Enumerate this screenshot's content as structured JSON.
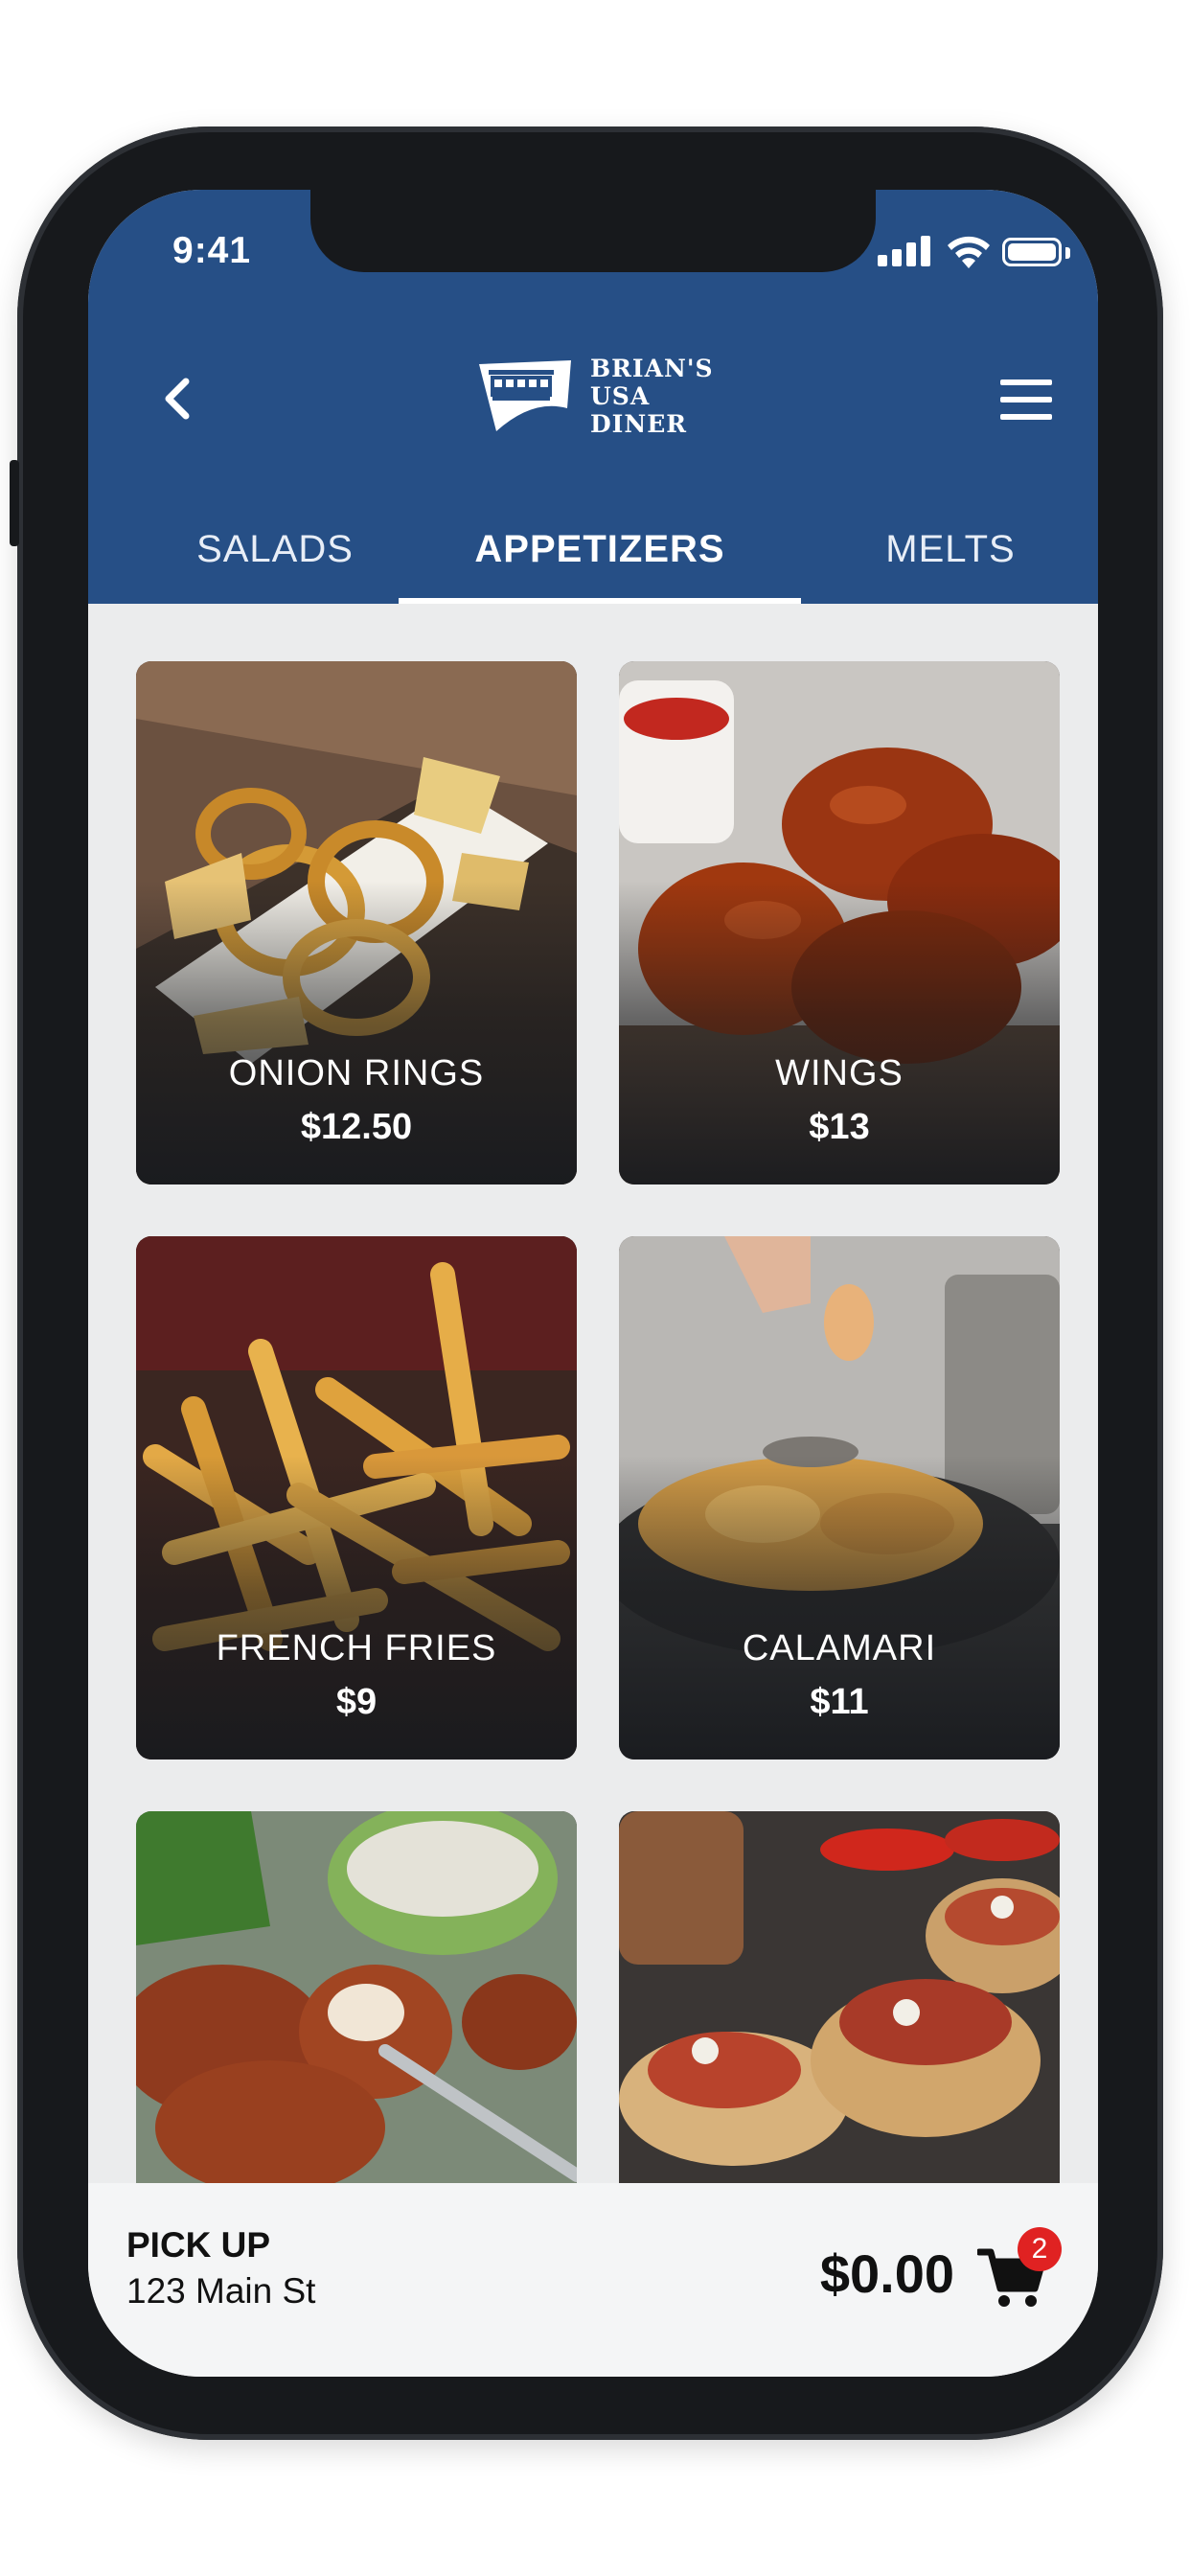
{
  "status_bar": {
    "time": "9:41"
  },
  "header": {
    "logo": {
      "line1": "BRIAN'S",
      "line2": "USA",
      "line3": "DINER"
    },
    "back_icon": "chevron-left-icon",
    "menu_icon": "hamburger-icon",
    "background_color": "#264f86"
  },
  "tabs": [
    {
      "label": "SALADS",
      "active": false
    },
    {
      "label": "APPETIZERS",
      "active": true
    },
    {
      "label": "MELTS",
      "active": false
    }
  ],
  "items": [
    {
      "name": "ONION RINGS",
      "price": "$12.50"
    },
    {
      "name": "WINGS",
      "price": "$13"
    },
    {
      "name": "FRENCH FRIES",
      "price": "$9"
    },
    {
      "name": "CALAMARI",
      "price": "$11"
    },
    {
      "name": "",
      "price": ""
    },
    {
      "name": "",
      "price": ""
    }
  ],
  "footer": {
    "pickup_label": "PICK UP",
    "address": "123 Main St",
    "cart_total": "$0.00",
    "cart_count": "2",
    "cart_icon": "shopping-cart-icon",
    "badge_color": "#e02222"
  }
}
